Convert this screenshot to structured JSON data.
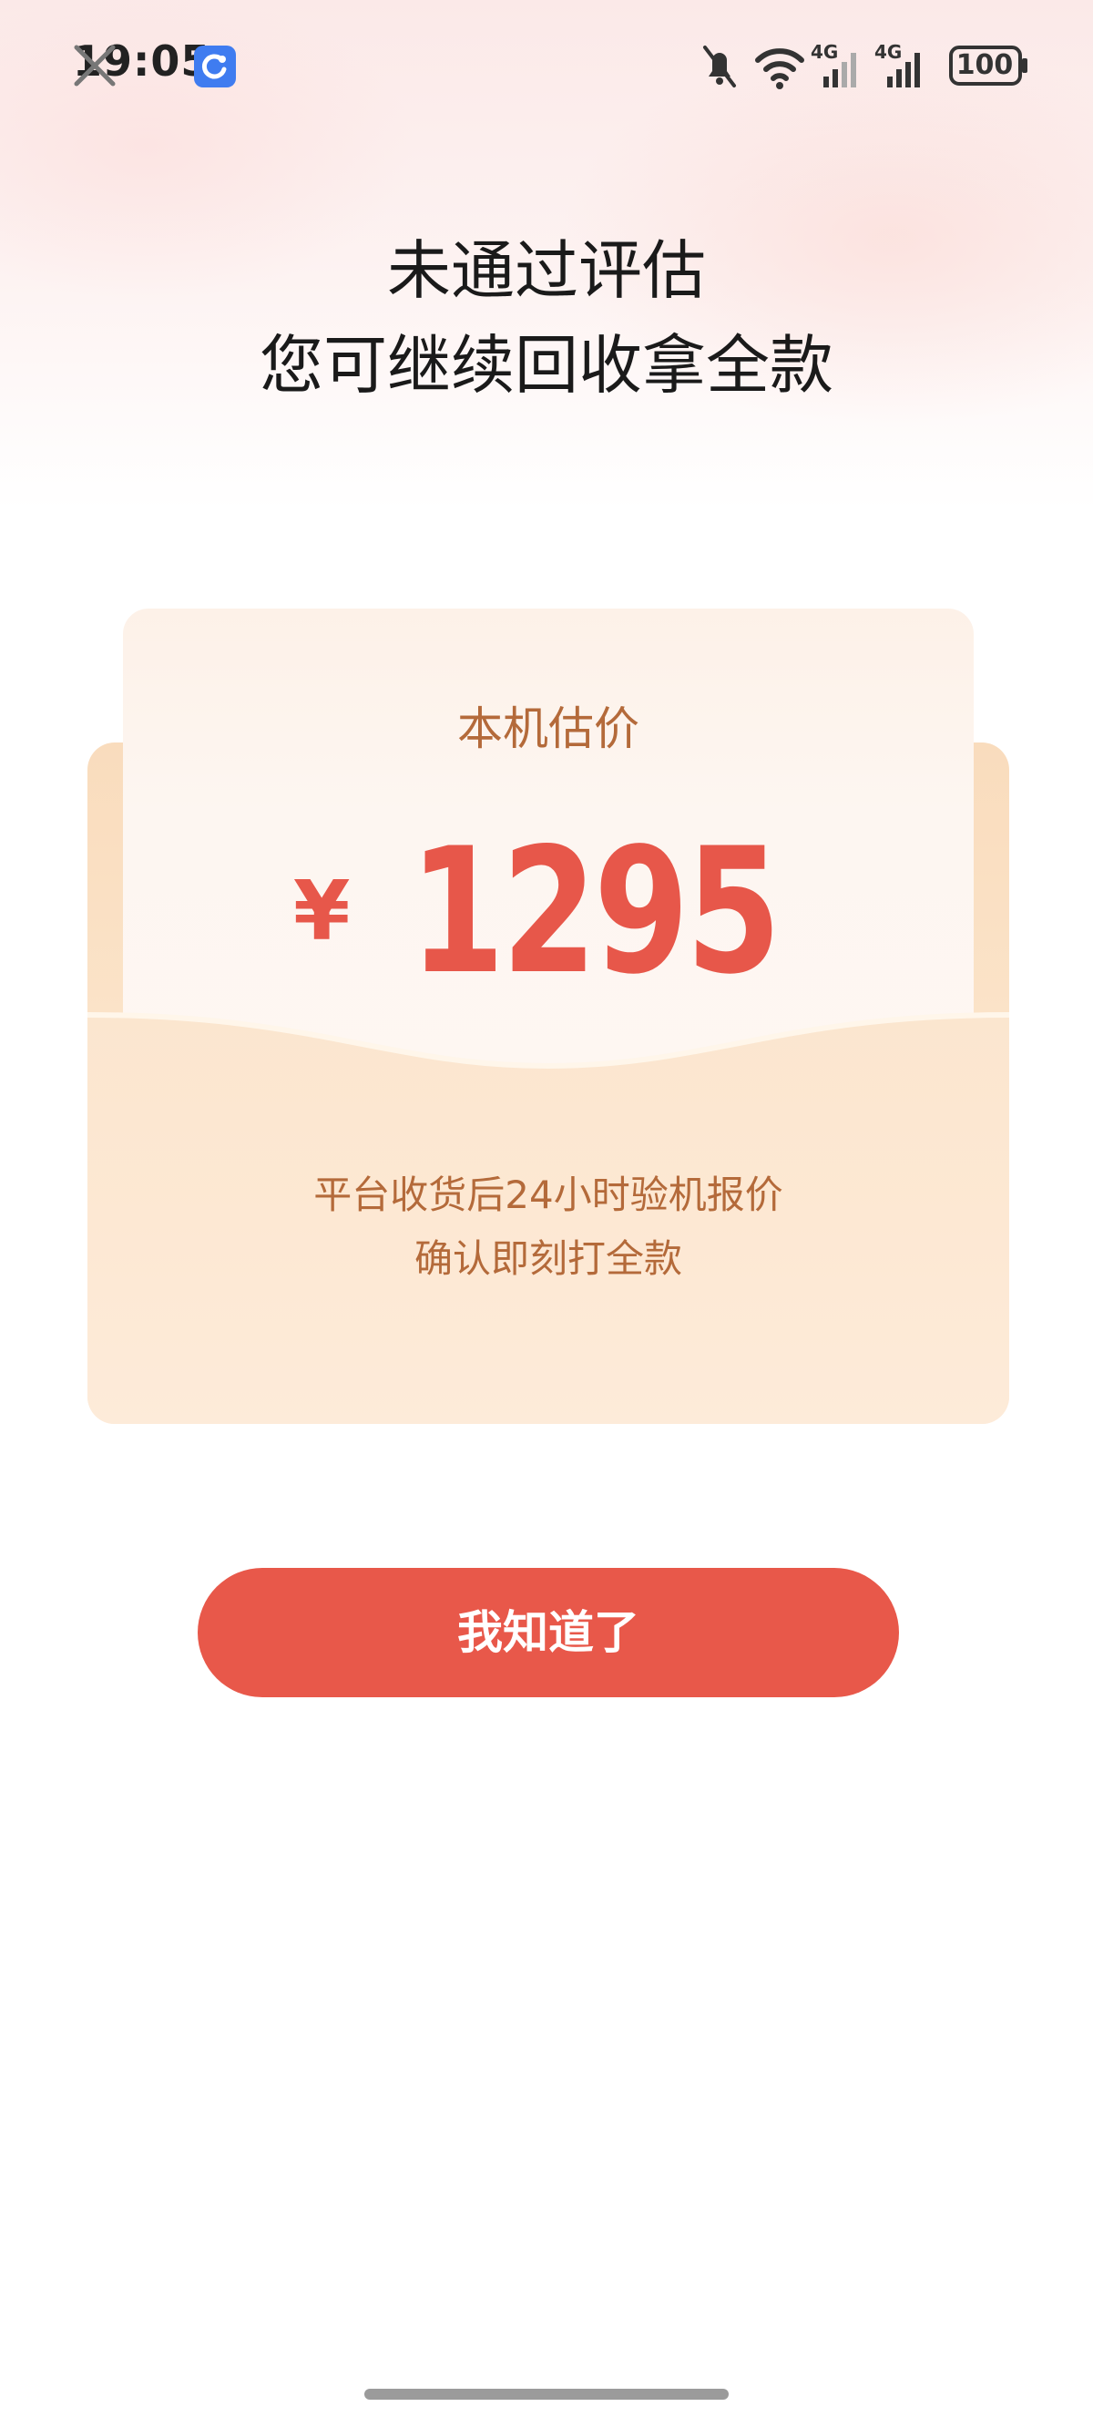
{
  "status_bar": {
    "time": "19:05",
    "battery": "100",
    "network_left": "4G",
    "network_right": "4G"
  },
  "header": {
    "title_line1": "未通过评估",
    "title_line2": "您可继续回收拿全款"
  },
  "estimate_card": {
    "label": "本机估价",
    "currency": "¥",
    "amount": "1295",
    "info_line1": "平台收货后24小时验机报价",
    "info_line2": "确认即刻打全款"
  },
  "actions": {
    "ok_label": "我知道了"
  },
  "colors": {
    "accent": "#e8584a",
    "label_brown": "#b46a3a",
    "card_peach": "#fbe3c8"
  },
  "icons": [
    "app-notification-icon",
    "mute-bell-icon",
    "wifi-icon",
    "signal-4g-icon",
    "signal-4g-icon",
    "battery-icon"
  ]
}
